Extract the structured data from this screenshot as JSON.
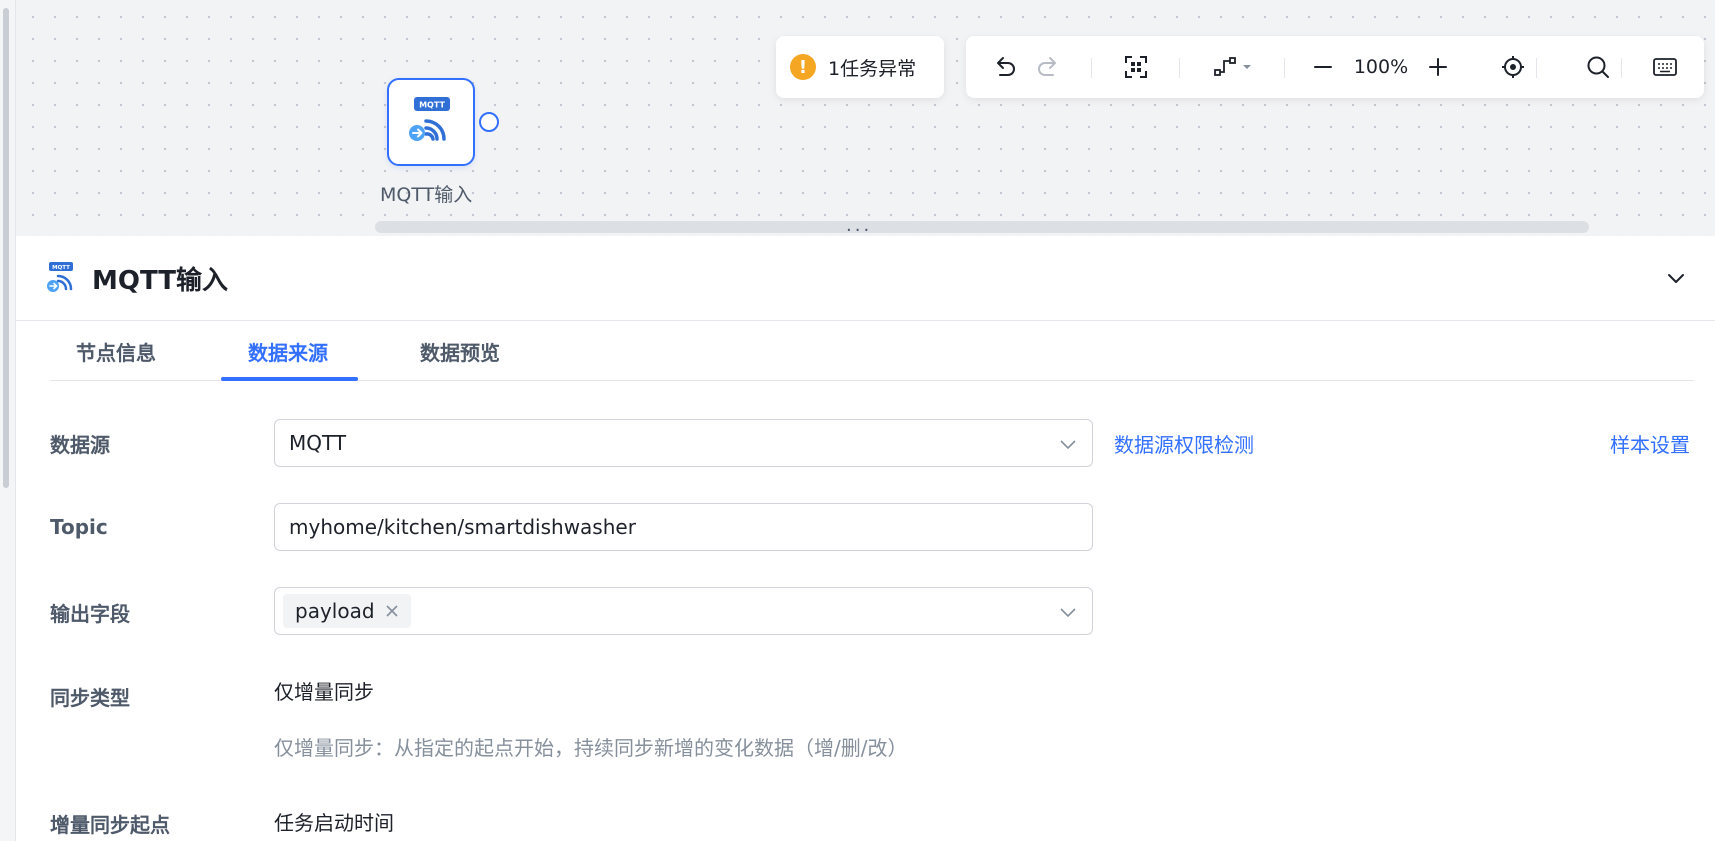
{
  "canvas": {
    "node": {
      "label": "MQTT输入",
      "badge": "MQTT",
      "icon": "mqtt-input-icon"
    },
    "alert": {
      "text": "1任务异常",
      "icon": "warning-icon",
      "color": "#f5a623"
    },
    "toolbar": {
      "zoom": "100%",
      "icons": [
        "undo-icon",
        "redo-icon",
        "fit-view-icon",
        "connector-style-icon",
        "zoom-out-icon",
        "zoom-in-icon",
        "locate-icon",
        "search-icon",
        "keyboard-icon"
      ]
    }
  },
  "panel": {
    "title": "MQTT输入",
    "tabs": [
      {
        "label": "节点信息",
        "active": false
      },
      {
        "label": "数据来源",
        "active": true
      },
      {
        "label": "数据预览",
        "active": false
      }
    ],
    "form": {
      "datasource": {
        "label": "数据源",
        "value": "MQTT",
        "permission_link": "数据源权限检测",
        "sample_link": "样本设置"
      },
      "topic": {
        "label": "Topic",
        "value": "myhome/kitchen/smartdishwasher"
      },
      "output_fields": {
        "label": "输出字段",
        "tags": [
          "payload"
        ]
      },
      "sync_type": {
        "label": "同步类型",
        "value": "仅增量同步",
        "hint": "仅增量同步：从指定的起点开始，持续同步新增的变化数据（增/删/改）"
      },
      "sync_start": {
        "label": "增量同步起点",
        "value": "任务启动时间"
      }
    }
  },
  "colors": {
    "accent": "#3370ff",
    "warning": "#f5a623"
  }
}
